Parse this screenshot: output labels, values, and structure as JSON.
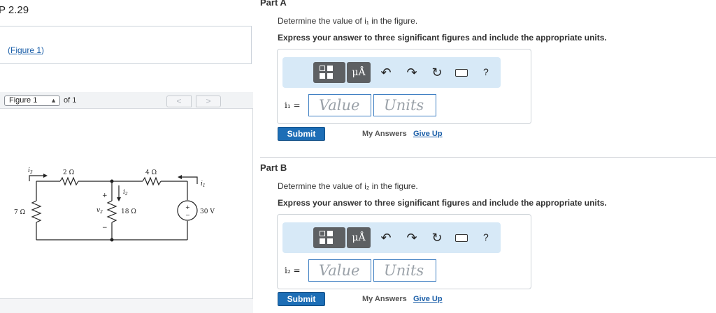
{
  "problem": {
    "title": "P 2.29",
    "figure_link": "Figure 1"
  },
  "figure_viewer": {
    "select_value": "Figure 1",
    "of_label": "of 1",
    "prev_label": "<",
    "next_label": ">"
  },
  "circuit": {
    "labels": {
      "i3": "i",
      "i3_sub": "3",
      "r2": "2 Ω",
      "r4": "4 Ω",
      "r7": "7 Ω",
      "r18": "18 Ω",
      "i1": "i",
      "i1_sub": "1",
      "i2": "i",
      "i2_sub": "2",
      "v2": "v",
      "v2_sub": "2",
      "plus": "+",
      "minus": "−",
      "src": "30 V",
      "src_plus": "+",
      "src_minus": "−"
    }
  },
  "part_a": {
    "heading": "Part A",
    "question": "Determine the value of i₁ in the figure.",
    "instruction": "Express your answer to three significant figures and include the appropriate units.",
    "ua_label": "μÅ",
    "var_label": "i₁ =",
    "value_placeholder": "Value",
    "units_placeholder": "Units",
    "submit_label": "Submit",
    "my_answers": "My Answers",
    "give_up": "Give Up",
    "help": "?"
  },
  "part_b": {
    "heading": "Part B",
    "question": "Determine the value of i₂ in the figure.",
    "instruction": "Express your answer to three significant figures and include the appropriate units.",
    "ua_label": "μÅ",
    "var_label": "i₂ =",
    "value_placeholder": "Value",
    "units_placeholder": "Units",
    "submit_label": "Submit",
    "my_answers": "My Answers",
    "give_up": "Give Up",
    "help": "?"
  },
  "icons": [
    "templates-icon",
    "undo-icon",
    "redo-icon",
    "reset-icon",
    "keyboard-icon",
    "help-icon"
  ],
  "colors": {
    "accent": "#1d6eb6",
    "toolbar": "#d7e9f7",
    "link": "#1a5ea8"
  }
}
